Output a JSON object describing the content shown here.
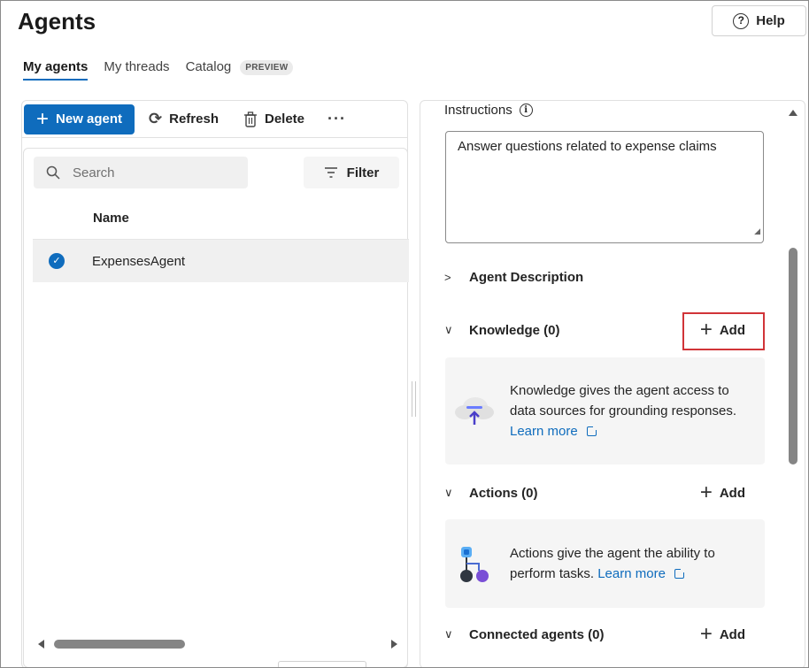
{
  "header": {
    "title": "Agents",
    "help_label": "Help",
    "help_icon": "question-circle-icon"
  },
  "tabs": [
    {
      "label": "My agents",
      "active": true
    },
    {
      "label": "My threads",
      "active": false
    },
    {
      "label": "Catalog",
      "active": false,
      "badge": "PREVIEW"
    }
  ],
  "toolbar": {
    "new_agent_label": "New agent",
    "refresh_label": "Refresh",
    "delete_label": "Delete",
    "more_label": "···"
  },
  "list": {
    "search_placeholder": "Search",
    "filter_label": "Filter",
    "column_header": "Name",
    "rows": [
      {
        "name": "ExpensesAgent",
        "selected": true
      }
    ]
  },
  "detail": {
    "instructions_label": "Instructions",
    "instructions_value": "Answer questions related to expense claims",
    "sections": {
      "agent_description": {
        "label": "Agent Description",
        "expanded": false
      },
      "knowledge": {
        "label": "Knowledge (0)",
        "expanded": true,
        "add_label": "Add",
        "card_line1": "Knowledge gives the agent access to",
        "card_line2": "data sources for grounding responses.",
        "learn_more": "Learn more"
      },
      "actions": {
        "label": "Actions (0)",
        "expanded": true,
        "add_label": "Add",
        "card_line1": "Actions give the agent the ability to",
        "card_line2": "perform tasks.",
        "learn_more": "Learn more"
      },
      "connected_agents": {
        "label": "Connected agents (0)",
        "expanded": true,
        "add_label": "Add"
      }
    }
  },
  "colors": {
    "accent": "#0f6cbd",
    "highlight": "#d13438",
    "card_bg": "#f5f5f5"
  }
}
